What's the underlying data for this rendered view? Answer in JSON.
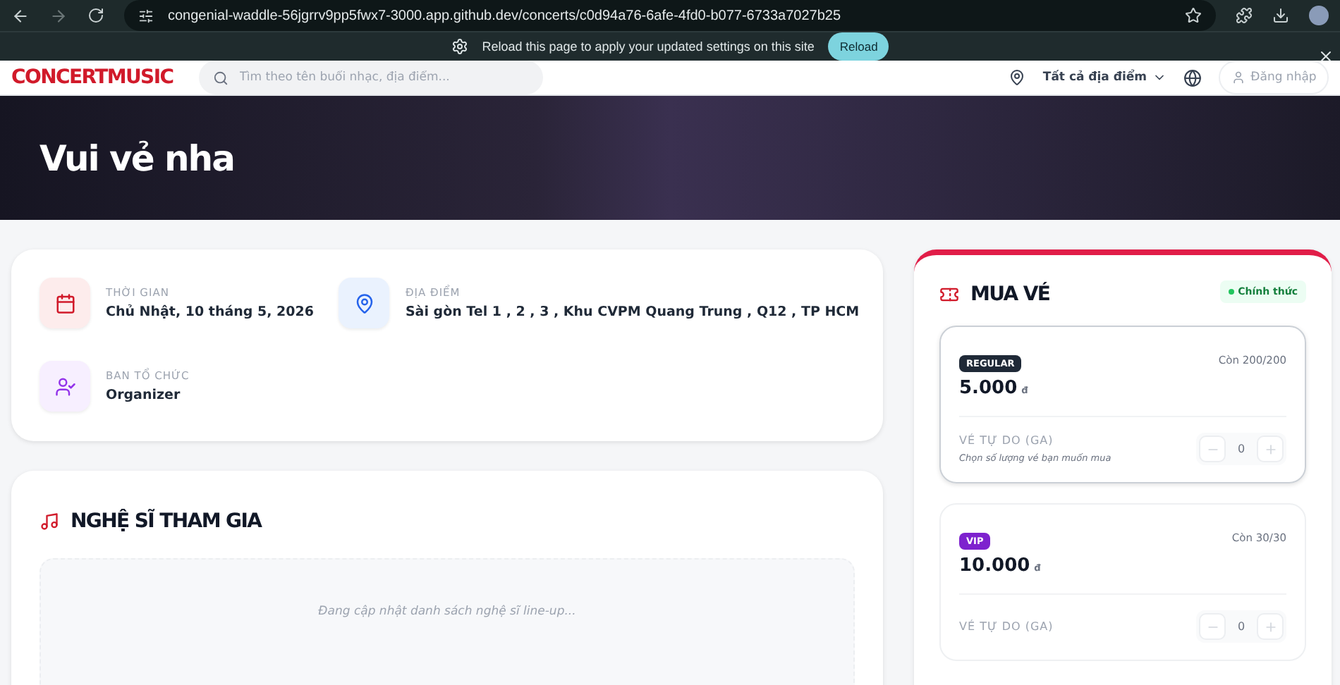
{
  "browser": {
    "url": "congenial-waddle-56jgrrv9pp5fwx7-3000.app.github.dev/concerts/c0d94a76-6afe-4fd0-b077-6733a7027b25"
  },
  "infobar": {
    "message": "Reload this page to apply your updated settings on this site",
    "button": "Reload"
  },
  "header": {
    "logo": "CONCERTMUSIC",
    "search": {
      "placeholder": "Tìm theo tên buổi nhạc, địa điểm..."
    },
    "location": "Tất cả địa điểm",
    "login": "Đăng nhập"
  },
  "hero": {
    "title": "Vui vẻ nha"
  },
  "info": [
    {
      "kind": "time",
      "label": "THỜI GIAN",
      "value": "Chủ Nhật, 10 tháng 5, 2026"
    },
    {
      "kind": "place",
      "label": "ĐỊA ĐIỂM",
      "value": "Sài gòn Tel 1 , 2 , 3 , Khu CVPM Quang Trung , Q12 , TP HCM"
    },
    {
      "kind": "organizer",
      "label": "BAN TỔ CHỨC",
      "value": "Organizer"
    }
  ],
  "artists": {
    "title": "NGHỆ SĨ THAM GIA",
    "empty": "Đang cập nhật danh sách nghệ sĩ line-up..."
  },
  "tickets": {
    "title": "MUA VÉ",
    "status": "Chính thức",
    "items": [
      {
        "badge": "REGULAR",
        "color": "#1f2937",
        "remaining": "Còn 200/200",
        "price": "5.000",
        "currency": "đ",
        "type": "VÉ TỰ DO (GA)",
        "hint": "Chọn số lượng vé bạn muốn mua",
        "quantity": "0",
        "selected": true
      },
      {
        "badge": "VIP",
        "color": "#7e22ce",
        "remaining": "Còn 30/30",
        "price": "10.000",
        "currency": "đ",
        "type": "VÉ TỰ DO (GA)",
        "quantity": "0",
        "selected": false
      }
    ]
  }
}
